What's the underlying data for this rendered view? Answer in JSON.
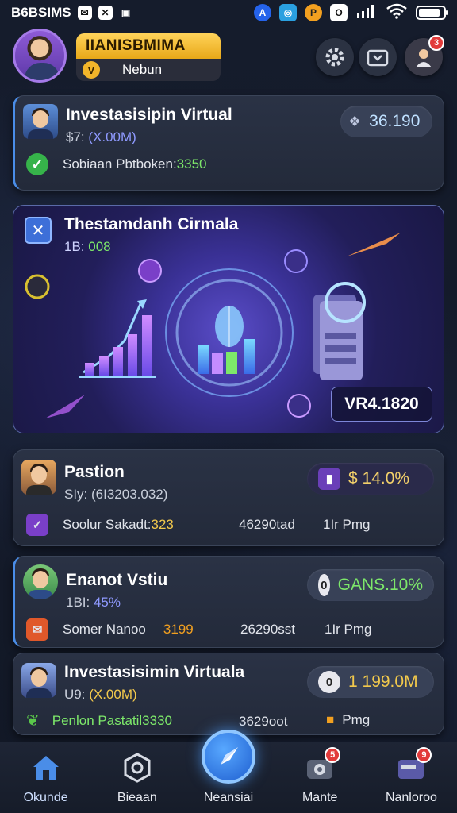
{
  "status_bar": {
    "time": "B6BSIMS",
    "icons": [
      "mail-icon",
      "x-icon",
      "image-icon"
    ],
    "apps": [
      "blue-app-icon",
      "teal-app-icon",
      "orange-app-icon",
      "white-app-icon"
    ]
  },
  "header": {
    "badge_title": "IIANISBMIMA",
    "badge_subtitle": "Nebun",
    "coin_glyph": "V",
    "notif_count": "3"
  },
  "cards": [
    {
      "title": "Investasisipin Virtual",
      "sub_label": "$7: ",
      "sub_value": "(X.00M)",
      "row_label": "Sobiaan Pbtboken: ",
      "row_value": "3350",
      "pill_value": "36.190",
      "accent": "#4a8de8"
    },
    {
      "title": "Pastion",
      "sub_label": "SIy: ",
      "sub_value": "(6I3203.032)",
      "row_label": "Soolur Sakadt: ",
      "row_value": "323",
      "row_mid": "46290tad",
      "row_right": "1Ir Pmg",
      "pill_value": "$ 14.0%"
    },
    {
      "title": "Enanot Vstiu",
      "sub_label": "1BI: ",
      "sub_value": "45%",
      "row_label": "Somer Nanoo",
      "row_value": "3199",
      "row_mid": "26290sst",
      "row_right": "1Ir Pmg",
      "pill_value": "GANS.10%"
    },
    {
      "title": "Investasisimin Virtuala",
      "sub_label": "U9: ",
      "sub_value": "(X.00M)",
      "row_label": "Penlon Pastatil ",
      "row_value": "3330",
      "row_mid": "3629oot",
      "row_right": "Pmg",
      "pill_value": "1 199.0M"
    }
  ],
  "hero": {
    "title": "Thestamdanh Cirmala",
    "sub_label": "1B: ",
    "sub_value": "008",
    "value": "VR4.1820"
  },
  "nav": [
    {
      "label": "Okunde",
      "icon": "home-icon",
      "active": true
    },
    {
      "label": "Bieaan",
      "icon": "hexagon-icon"
    },
    {
      "label": "Neansiai",
      "icon": "compass-icon"
    },
    {
      "label": "Mante",
      "icon": "camera-icon",
      "badge": "5"
    },
    {
      "label": "Nanloroo",
      "icon": "wallet-icon",
      "badge": "9"
    }
  ],
  "colors": {
    "accent_blue": "#4a8de8",
    "gold": "#f2b52a",
    "green": "#7de86a",
    "yellow": "#f2c94c",
    "purple_bg": "#3a3196"
  }
}
